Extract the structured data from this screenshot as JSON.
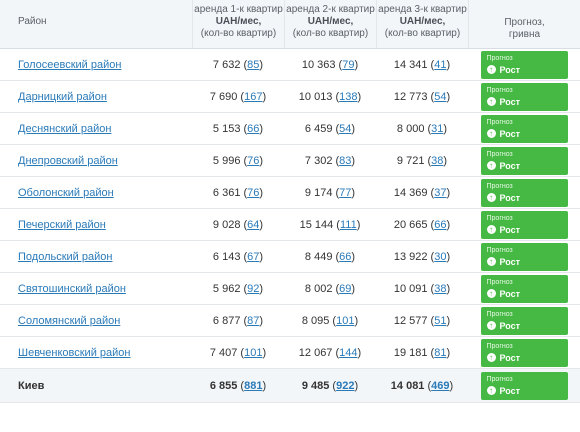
{
  "header": {
    "region": "Район",
    "col1": [
      "аренда 1-к квартир",
      "UAH/мес,",
      "(кол-во квартир)"
    ],
    "col2": [
      "аренда 2-к квартир",
      "UAH/мес,",
      "(кол-во квартир)"
    ],
    "col3": [
      "аренда 3-к квартир",
      "UAH/мес,",
      "(кол-во квартир)"
    ],
    "forecast": [
      "Прогноз,",
      "гривна"
    ]
  },
  "rows": [
    {
      "name": "Голосеевский район",
      "r1": "7 632",
      "c1": "85",
      "r2": "10 363",
      "c2": "79",
      "r3": "14 341",
      "c3": "41",
      "badge_label": "Прогноз",
      "badge_text": "Рост",
      "icon": "up-arrow-icon"
    },
    {
      "name": "Дарницкий район",
      "r1": "7 690",
      "c1": "167",
      "r2": "10 013",
      "c2": "138",
      "r3": "12 773",
      "c3": "54",
      "badge_label": "Прогноз",
      "badge_text": "Рост",
      "icon": "up-arrow-icon"
    },
    {
      "name": "Деснянский район",
      "r1": "5 153",
      "c1": "66",
      "r2": "6 459",
      "c2": "54",
      "r3": "8 000",
      "c3": "31",
      "badge_label": "Прогноз",
      "badge_text": "Рост",
      "icon": "up-arrow-icon"
    },
    {
      "name": "Днепровский район",
      "r1": "5 996",
      "c1": "76",
      "r2": "7 302",
      "c2": "83",
      "r3": "9 721",
      "c3": "38",
      "badge_label": "Прогноз",
      "badge_text": "Рост",
      "icon": "up-arrow-icon"
    },
    {
      "name": "Оболонский район",
      "r1": "6 361",
      "c1": "76",
      "r2": "9 174",
      "c2": "77",
      "r3": "14 369",
      "c3": "37",
      "badge_label": "Прогноз",
      "badge_text": "Рост",
      "icon": "up-arrow-icon"
    },
    {
      "name": "Печерский район",
      "r1": "9 028",
      "c1": "64",
      "r2": "15 144",
      "c2": "111",
      "r3": "20 665",
      "c3": "66",
      "badge_label": "Прогноз",
      "badge_text": "Рост",
      "icon": "up-arrow-icon"
    },
    {
      "name": "Подольский район",
      "r1": "6 143",
      "c1": "67",
      "r2": "8 449",
      "c2": "66",
      "r3": "13 922",
      "c3": "30",
      "badge_label": "Прогноз",
      "badge_text": "Рост",
      "icon": "up-arrow-icon"
    },
    {
      "name": "Святошинский район",
      "r1": "5 962",
      "c1": "92",
      "r2": "8 002",
      "c2": "69",
      "r3": "10 091",
      "c3": "38",
      "badge_label": "Прогноз",
      "badge_text": "Рост",
      "icon": "up-arrow-icon"
    },
    {
      "name": "Соломянский район",
      "r1": "6 877",
      "c1": "87",
      "r2": "8 095",
      "c2": "101",
      "r3": "12 577",
      "c3": "51",
      "badge_label": "Прогноз",
      "badge_text": "Рост",
      "icon": "up-arrow-icon"
    },
    {
      "name": "Шевченковский район",
      "r1": "7 407",
      "c1": "101",
      "r2": "12 067",
      "c2": "144",
      "r3": "19 181",
      "c3": "81",
      "badge_label": "Прогноз",
      "badge_text": "Рост",
      "icon": "up-arrow-icon"
    }
  ],
  "total": {
    "name": "Киев",
    "r1": "6 855",
    "c1": "881",
    "r2": "9 485",
    "c2": "922",
    "r3": "14 081",
    "c3": "469",
    "badge_label": "Прогноз",
    "badge_text": "Рост",
    "icon": "up-arrow-icon"
  },
  "colors": {
    "badge": "#45b943",
    "link": "#2a7ab8",
    "header_bg": "#f3f6f9"
  }
}
